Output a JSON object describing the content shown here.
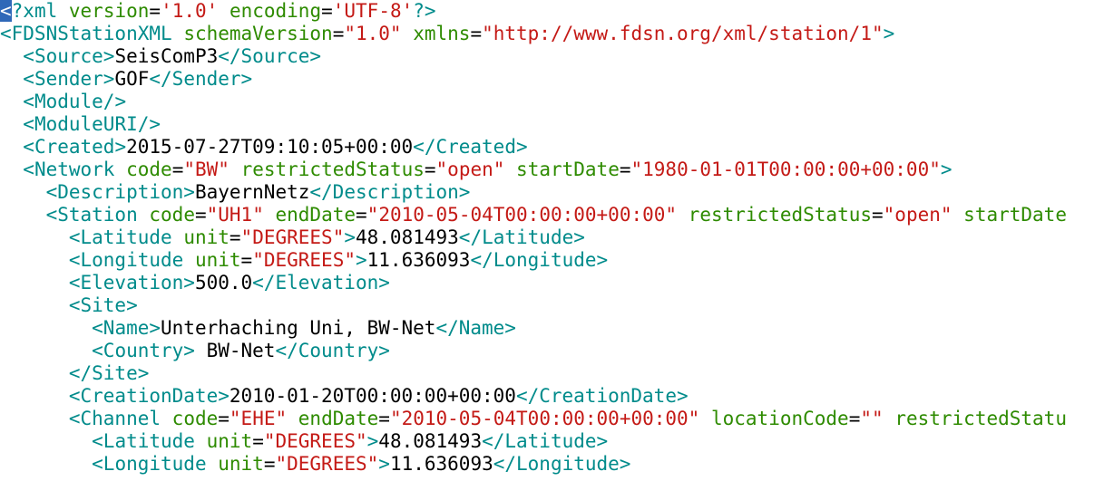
{
  "colors": {
    "tag": "#008b8b",
    "attr_name": "#2e8b00",
    "attr_value": "#c41a16",
    "text": "#000000",
    "cursor_bg": "#2f68b8",
    "cursor_fg": "#ffffff",
    "background": "#ffffff"
  },
  "indent_unit": 2,
  "lines": [
    {
      "indent": 0,
      "tokens": [
        {
          "t": "tag",
          "v": "<",
          "cursor": true
        },
        {
          "t": "tag",
          "v": "?xml"
        },
        {
          "t": "text",
          "v": " "
        },
        {
          "t": "attr",
          "v": "version"
        },
        {
          "t": "text",
          "v": "="
        },
        {
          "t": "val",
          "v": "'1.0'"
        },
        {
          "t": "text",
          "v": " "
        },
        {
          "t": "attr",
          "v": "encoding"
        },
        {
          "t": "text",
          "v": "="
        },
        {
          "t": "val",
          "v": "'UTF-8'"
        },
        {
          "t": "tag",
          "v": "?>"
        }
      ]
    },
    {
      "indent": 0,
      "tokens": [
        {
          "t": "tag",
          "v": "<FDSNStationXML"
        },
        {
          "t": "text",
          "v": " "
        },
        {
          "t": "attr",
          "v": "schemaVersion"
        },
        {
          "t": "text",
          "v": "="
        },
        {
          "t": "val",
          "v": "\"1.0\""
        },
        {
          "t": "text",
          "v": " "
        },
        {
          "t": "attr",
          "v": "xmlns"
        },
        {
          "t": "text",
          "v": "="
        },
        {
          "t": "val",
          "v": "\"http://www.fdsn.org/xml/station/1\""
        },
        {
          "t": "tag",
          "v": ">"
        }
      ]
    },
    {
      "indent": 1,
      "tokens": [
        {
          "t": "tag",
          "v": "<Source>"
        },
        {
          "t": "text",
          "v": "SeisComP3"
        },
        {
          "t": "tag",
          "v": "</Source>"
        }
      ]
    },
    {
      "indent": 1,
      "tokens": [
        {
          "t": "tag",
          "v": "<Sender>"
        },
        {
          "t": "text",
          "v": "GOF"
        },
        {
          "t": "tag",
          "v": "</Sender>"
        }
      ]
    },
    {
      "indent": 1,
      "tokens": [
        {
          "t": "tag",
          "v": "<Module/>"
        }
      ]
    },
    {
      "indent": 1,
      "tokens": [
        {
          "t": "tag",
          "v": "<ModuleURI/>"
        }
      ]
    },
    {
      "indent": 1,
      "tokens": [
        {
          "t": "tag",
          "v": "<Created>"
        },
        {
          "t": "text",
          "v": "2015-07-27T09:10:05+00:00"
        },
        {
          "t": "tag",
          "v": "</Created>"
        }
      ]
    },
    {
      "indent": 1,
      "tokens": [
        {
          "t": "tag",
          "v": "<Network"
        },
        {
          "t": "text",
          "v": " "
        },
        {
          "t": "attr",
          "v": "code"
        },
        {
          "t": "text",
          "v": "="
        },
        {
          "t": "val",
          "v": "\"BW\""
        },
        {
          "t": "text",
          "v": " "
        },
        {
          "t": "attr",
          "v": "restrictedStatus"
        },
        {
          "t": "text",
          "v": "="
        },
        {
          "t": "val",
          "v": "\"open\""
        },
        {
          "t": "text",
          "v": " "
        },
        {
          "t": "attr",
          "v": "startDate"
        },
        {
          "t": "text",
          "v": "="
        },
        {
          "t": "val",
          "v": "\"1980-01-01T00:00:00+00:00\""
        },
        {
          "t": "tag",
          "v": ">"
        }
      ]
    },
    {
      "indent": 2,
      "tokens": [
        {
          "t": "tag",
          "v": "<Description>"
        },
        {
          "t": "text",
          "v": "BayernNetz"
        },
        {
          "t": "tag",
          "v": "</Description>"
        }
      ]
    },
    {
      "indent": 2,
      "tokens": [
        {
          "t": "tag",
          "v": "<Station"
        },
        {
          "t": "text",
          "v": " "
        },
        {
          "t": "attr",
          "v": "code"
        },
        {
          "t": "text",
          "v": "="
        },
        {
          "t": "val",
          "v": "\"UH1\""
        },
        {
          "t": "text",
          "v": " "
        },
        {
          "t": "attr",
          "v": "endDate"
        },
        {
          "t": "text",
          "v": "="
        },
        {
          "t": "val",
          "v": "\"2010-05-04T00:00:00+00:00\""
        },
        {
          "t": "text",
          "v": " "
        },
        {
          "t": "attr",
          "v": "restrictedStatus"
        },
        {
          "t": "text",
          "v": "="
        },
        {
          "t": "val",
          "v": "\"open\""
        },
        {
          "t": "text",
          "v": " "
        },
        {
          "t": "attr",
          "v": "startDate"
        }
      ]
    },
    {
      "indent": 3,
      "tokens": [
        {
          "t": "tag",
          "v": "<Latitude"
        },
        {
          "t": "text",
          "v": " "
        },
        {
          "t": "attr",
          "v": "unit"
        },
        {
          "t": "text",
          "v": "="
        },
        {
          "t": "val",
          "v": "\"DEGREES\""
        },
        {
          "t": "tag",
          "v": ">"
        },
        {
          "t": "text",
          "v": "48.081493"
        },
        {
          "t": "tag",
          "v": "</Latitude>"
        }
      ]
    },
    {
      "indent": 3,
      "tokens": [
        {
          "t": "tag",
          "v": "<Longitude"
        },
        {
          "t": "text",
          "v": " "
        },
        {
          "t": "attr",
          "v": "unit"
        },
        {
          "t": "text",
          "v": "="
        },
        {
          "t": "val",
          "v": "\"DEGREES\""
        },
        {
          "t": "tag",
          "v": ">"
        },
        {
          "t": "text",
          "v": "11.636093"
        },
        {
          "t": "tag",
          "v": "</Longitude>"
        }
      ]
    },
    {
      "indent": 3,
      "tokens": [
        {
          "t": "tag",
          "v": "<Elevation>"
        },
        {
          "t": "text",
          "v": "500.0"
        },
        {
          "t": "tag",
          "v": "</Elevation>"
        }
      ]
    },
    {
      "indent": 3,
      "tokens": [
        {
          "t": "tag",
          "v": "<Site>"
        }
      ]
    },
    {
      "indent": 4,
      "tokens": [
        {
          "t": "tag",
          "v": "<Name>"
        },
        {
          "t": "text",
          "v": "Unterhaching Uni, BW-Net"
        },
        {
          "t": "tag",
          "v": "</Name>"
        }
      ]
    },
    {
      "indent": 4,
      "tokens": [
        {
          "t": "tag",
          "v": "<Country>"
        },
        {
          "t": "text",
          "v": " BW-Net"
        },
        {
          "t": "tag",
          "v": "</Country>"
        }
      ]
    },
    {
      "indent": 3,
      "tokens": [
        {
          "t": "tag",
          "v": "</Site>"
        }
      ]
    },
    {
      "indent": 3,
      "tokens": [
        {
          "t": "tag",
          "v": "<CreationDate>"
        },
        {
          "t": "text",
          "v": "2010-01-20T00:00:00+00:00"
        },
        {
          "t": "tag",
          "v": "</CreationDate>"
        }
      ]
    },
    {
      "indent": 3,
      "tokens": [
        {
          "t": "tag",
          "v": "<Channel"
        },
        {
          "t": "text",
          "v": " "
        },
        {
          "t": "attr",
          "v": "code"
        },
        {
          "t": "text",
          "v": "="
        },
        {
          "t": "val",
          "v": "\"EHE\""
        },
        {
          "t": "text",
          "v": " "
        },
        {
          "t": "attr",
          "v": "endDate"
        },
        {
          "t": "text",
          "v": "="
        },
        {
          "t": "val",
          "v": "\"2010-05-04T00:00:00+00:00\""
        },
        {
          "t": "text",
          "v": " "
        },
        {
          "t": "attr",
          "v": "locationCode"
        },
        {
          "t": "text",
          "v": "="
        },
        {
          "t": "val",
          "v": "\"\""
        },
        {
          "t": "text",
          "v": " "
        },
        {
          "t": "attr",
          "v": "restrictedStatu"
        }
      ]
    },
    {
      "indent": 4,
      "tokens": [
        {
          "t": "tag",
          "v": "<Latitude"
        },
        {
          "t": "text",
          "v": " "
        },
        {
          "t": "attr",
          "v": "unit"
        },
        {
          "t": "text",
          "v": "="
        },
        {
          "t": "val",
          "v": "\"DEGREES\""
        },
        {
          "t": "tag",
          "v": ">"
        },
        {
          "t": "text",
          "v": "48.081493"
        },
        {
          "t": "tag",
          "v": "</Latitude>"
        }
      ]
    },
    {
      "indent": 4,
      "tokens": [
        {
          "t": "tag",
          "v": "<Longitude"
        },
        {
          "t": "text",
          "v": " "
        },
        {
          "t": "attr",
          "v": "unit"
        },
        {
          "t": "text",
          "v": "="
        },
        {
          "t": "val",
          "v": "\"DEGREES\""
        },
        {
          "t": "tag",
          "v": ">"
        },
        {
          "t": "text",
          "v": "11.636093"
        },
        {
          "t": "tag",
          "v": "</Longitude>"
        }
      ]
    }
  ]
}
